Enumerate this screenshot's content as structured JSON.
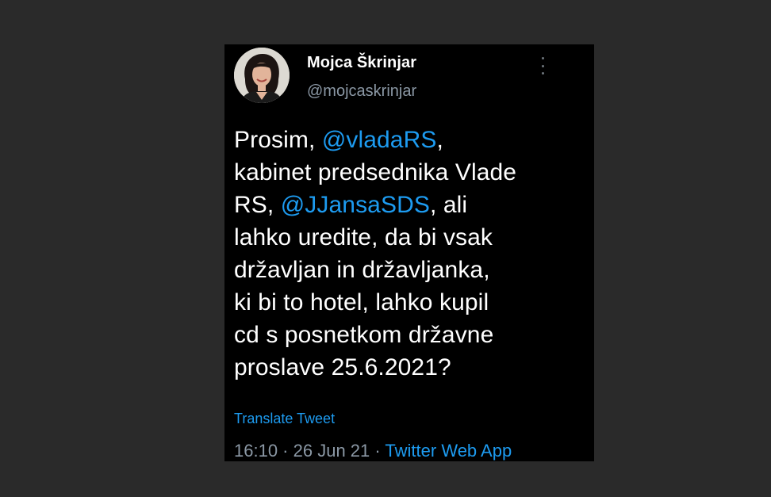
{
  "author": {
    "display_name": "Mojca Škrinjar",
    "handle": "@mojcaskrinjar"
  },
  "tweet": {
    "lines": [
      [
        {
          "text": "Prosim, ",
          "type": "text"
        },
        {
          "text": "@vladaRS",
          "type": "mention"
        },
        {
          "text": ",",
          "type": "text"
        }
      ],
      [
        {
          "text": "kabinet predsednika Vlade",
          "type": "text"
        }
      ],
      [
        {
          "text": "RS, ",
          "type": "text"
        },
        {
          "text": "@JJansaSDS",
          "type": "mention"
        },
        {
          "text": ", ali",
          "type": "text"
        }
      ],
      [
        {
          "text": "lahko uredite, da bi vsak",
          "type": "text"
        }
      ],
      [
        {
          "text": "državljan in državljanka,",
          "type": "text"
        }
      ],
      [
        {
          "text": "ki bi to hotel, lahko kupil",
          "type": "text"
        }
      ],
      [
        {
          "text": "cd s posnetkom državne",
          "type": "text"
        }
      ],
      [
        {
          "text": "proslave 25.6.2021?",
          "type": "text"
        }
      ]
    ],
    "translate_label": "Translate Tweet",
    "time": "16:10",
    "separator": " · ",
    "date": "26 Jun 21",
    "source": "Twitter Web App"
  },
  "icons": {
    "more": "more-vertical-icon"
  },
  "colors": {
    "background": "#000000",
    "text": "#ffffff",
    "muted": "#8b98a5",
    "link": "#1d9bf0"
  }
}
